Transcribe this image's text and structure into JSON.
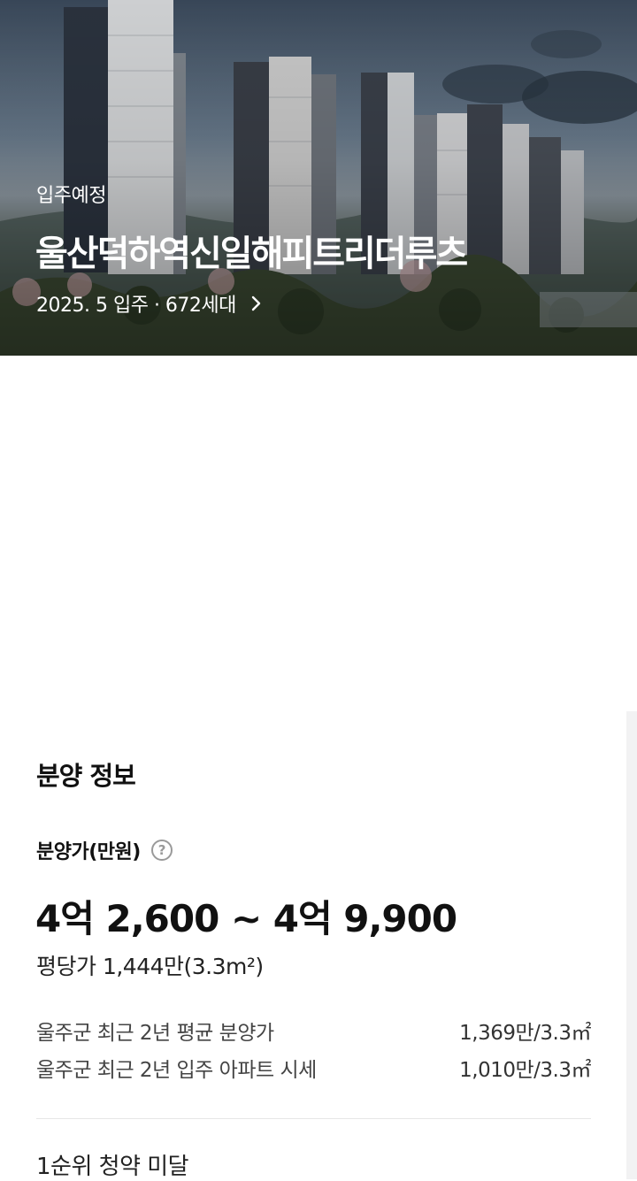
{
  "hero": {
    "kicker": "입주예정",
    "title": "울산덕하역신일해피트리더루츠",
    "meta": "2025. 5 입주 · 672세대",
    "chevron_icon": "chevron-right-icon"
  },
  "sale_info": {
    "section_title": "분양 정보",
    "price_label": "분양가(만원)",
    "help_icon": "question-circle-icon",
    "help_glyph": "?",
    "price_range": "4억 2,600 ~ 4억 9,900",
    "unit_price": "평당가 1,444만(3.3m²)",
    "stats": [
      {
        "label": "울주군 최근 2년 평균 분양가",
        "value": "1,369만/3.3㎡"
      },
      {
        "label": "울주군 최근 2년 입주 아파트 시세",
        "value": "1,010만/3.3㎡"
      }
    ],
    "subscription": "1순위 청약 미달"
  }
}
